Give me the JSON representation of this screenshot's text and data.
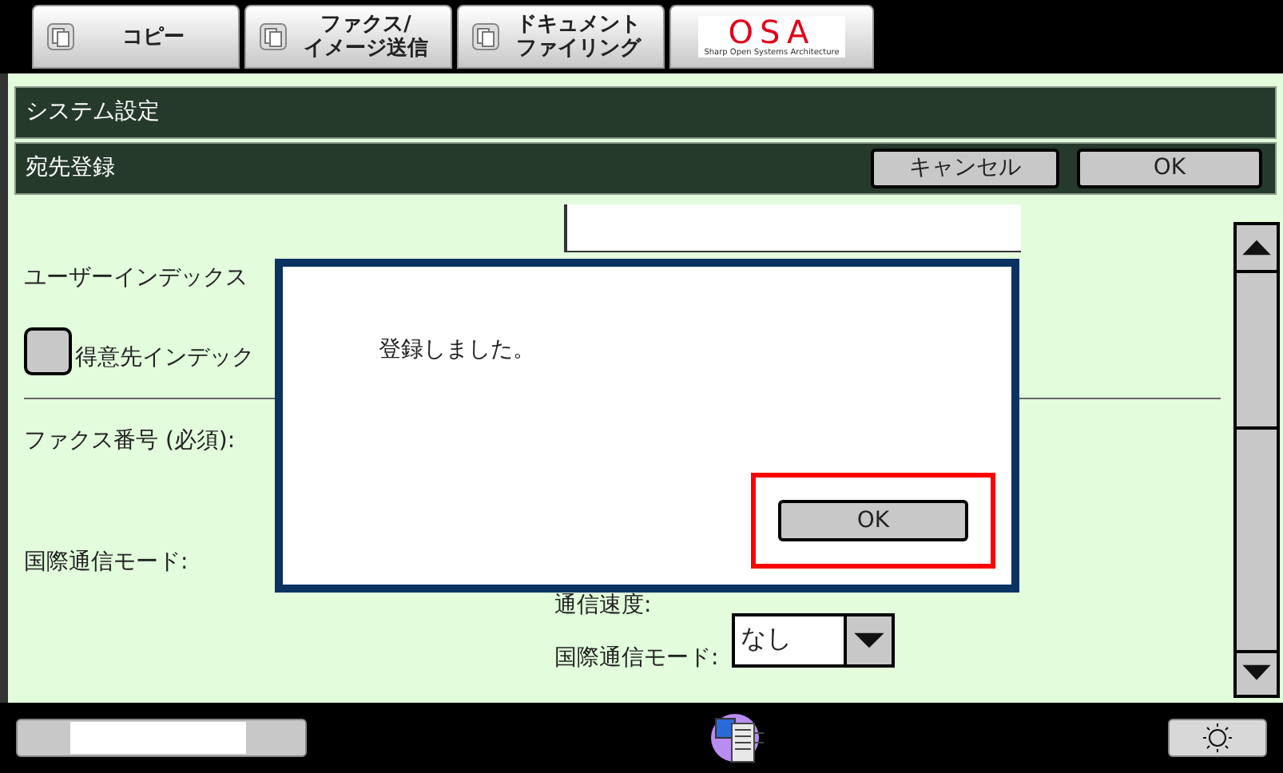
{
  "tabs": [
    {
      "lines": [
        "コピー"
      ],
      "selected": false
    },
    {
      "lines": [
        "ファクス/",
        "イメージ送信"
      ],
      "selected": false
    },
    {
      "lines": [
        "ドキュメント",
        "ファイリング"
      ],
      "selected": false
    }
  ],
  "logo": {
    "text": "OSA",
    "subtitle": "Sharp Open Systems Architecture"
  },
  "breadcrumb": "システム設定",
  "page": {
    "title": "宛先登録",
    "buttons": [
      "キャンセル",
      "OK"
    ]
  },
  "form": {
    "user_index_label": "ユーザーインデックス",
    "favorite": {
      "label": "得意先インデック",
      "checked": false
    },
    "fax_label": "ファクス番号 (必須):",
    "intl_label": "国際通信モード:",
    "speed_label": "通信速度:",
    "intl_mode": {
      "label": "国際通信モード:",
      "value": "なし"
    }
  },
  "dialog": {
    "message": "登録しました。",
    "button": {
      "label": "OK",
      "highlighted": true
    }
  }
}
